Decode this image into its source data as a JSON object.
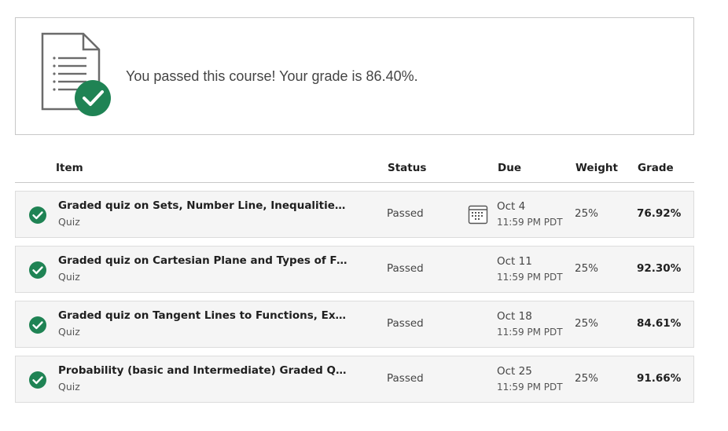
{
  "banner": {
    "message": "You passed this course! Your grade is 86.40%.",
    "icon": "document-check-icon"
  },
  "table": {
    "headers": {
      "item": "Item",
      "status": "Status",
      "due": "Due",
      "weight": "Weight",
      "grade": "Grade"
    },
    "rows": [
      {
        "title": "Graded quiz on Sets, Number Line, Inequalities, Si…",
        "type": "Quiz",
        "status": "Passed",
        "due_date": "Oct 4",
        "due_time": "11:59 PM PDT",
        "weight": "25%",
        "grade": "76.92%"
      },
      {
        "title": "Graded quiz on Cartesian Plane and Types of Funct…",
        "type": "Quiz",
        "status": "Passed",
        "due_date": "Oct 11",
        "due_time": "11:59 PM PDT",
        "weight": "25%",
        "grade": "92.30%"
      },
      {
        "title": "Graded quiz on Tangent Lines to Functions, Expone…",
        "type": "Quiz",
        "status": "Passed",
        "due_date": "Oct 18",
        "due_time": "11:59 PM PDT",
        "weight": "25%",
        "grade": "84.61%"
      },
      {
        "title": "Probability (basic and Intermediate) Graded Quiz",
        "type": "Quiz",
        "status": "Passed",
        "due_date": "Oct 25",
        "due_time": "11:59 PM PDT",
        "weight": "25%",
        "grade": "91.66%"
      }
    ]
  },
  "colors": {
    "success": "#1f8354",
    "icon_gray": "#6b6b6b",
    "row_bg": "#f5f5f5"
  }
}
